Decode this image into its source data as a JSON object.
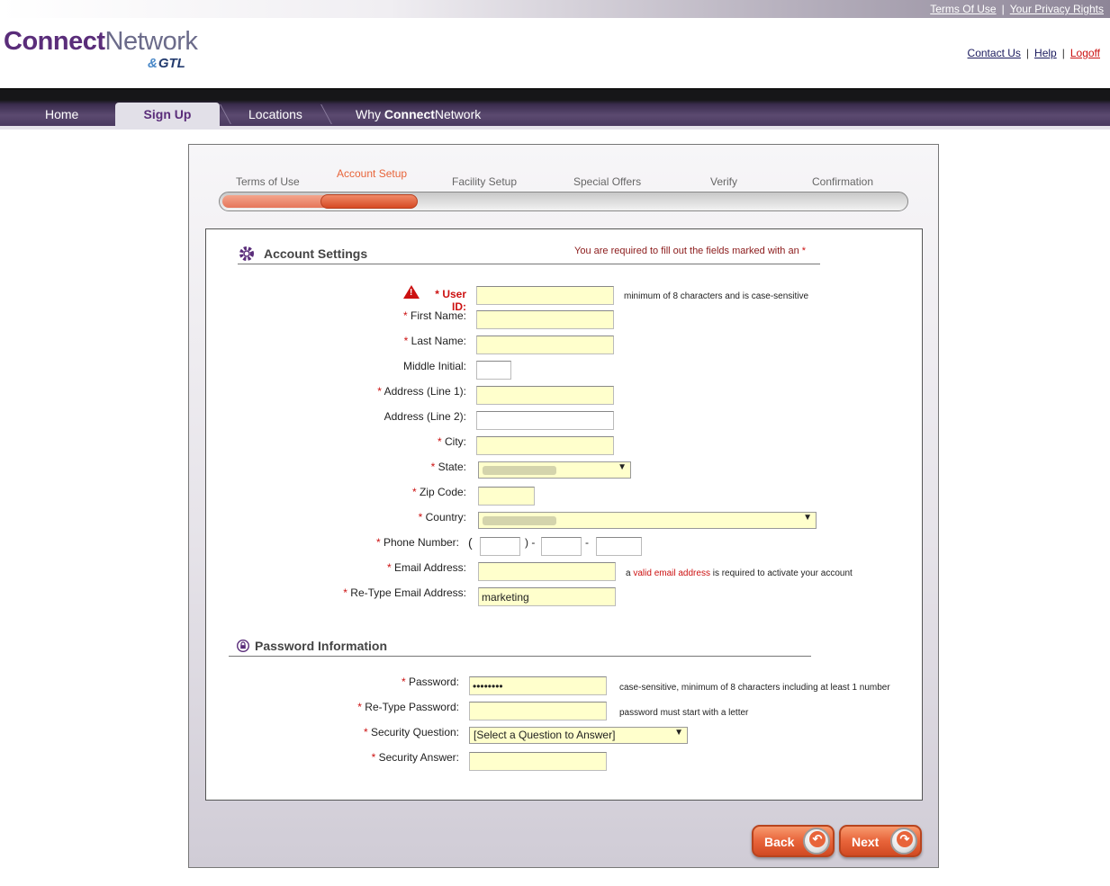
{
  "header": {
    "top_links": [
      "Terms Of Use",
      "Your Privacy Rights"
    ],
    "logo_bold": "Connect",
    "logo_light": "Network",
    "logo_sub": "GTL",
    "right_links": [
      "Contact Us",
      "Help",
      "Logoff"
    ]
  },
  "nav": {
    "items": [
      {
        "label": "Home"
      },
      {
        "label": "Sign Up",
        "active": true
      },
      {
        "label": "Locations"
      },
      {
        "label_prefix": "Why ",
        "label_bold": "Connect",
        "label_suffix": "Network"
      }
    ]
  },
  "steps": [
    "Terms of Use",
    "Account Setup",
    "Facility Setup",
    "Special Offers",
    "Verify",
    "Confirmation"
  ],
  "account": {
    "title": "Account Settings",
    "required_note": "You are required to fill out the fields marked with an",
    "required_star": "*",
    "fields": {
      "user_id": "User ID:",
      "first_name": "First Name:",
      "last_name": "Last Name:",
      "middle_initial": "Middle Initial:",
      "address1": "Address (Line 1):",
      "address2": "Address (Line 2):",
      "city": "City:",
      "state": "State:",
      "zip": "Zip Code:",
      "country": "Country:",
      "phone": "Phone Number:",
      "email": "Email Address:",
      "retype_email": "Re-Type Email Address:"
    },
    "retype_email_value": "marketing",
    "hints": {
      "user_id": "minimum of 8 characters and is case-sensitive",
      "email_pre": "a ",
      "email_link": "valid email address",
      "email_post": " is required to activate your account"
    },
    "phone_parts": {
      "open": "(",
      "close": ") -",
      "dash": "-"
    }
  },
  "password": {
    "title": "Password Information",
    "fields": {
      "password": "Password:",
      "retype_password": "Re-Type Password:",
      "security_question": "Security Question:",
      "security_answer": "Security Answer:"
    },
    "password_value": "••••••••",
    "question_selected": "[Select a Question to Answer]",
    "hints": {
      "password": "case-sensitive, minimum of 8 characters including at least 1 number",
      "retype_password": "password must start with a letter"
    }
  },
  "buttons": {
    "back": "Back",
    "next": "Next"
  },
  "colors": {
    "brand_purple": "#5a2d7a",
    "accent_orange": "#e8643a",
    "required_red": "#cc1111",
    "field_yellow": "#ffffcc"
  },
  "progress": {
    "current_step": 2,
    "total_steps": 6
  }
}
